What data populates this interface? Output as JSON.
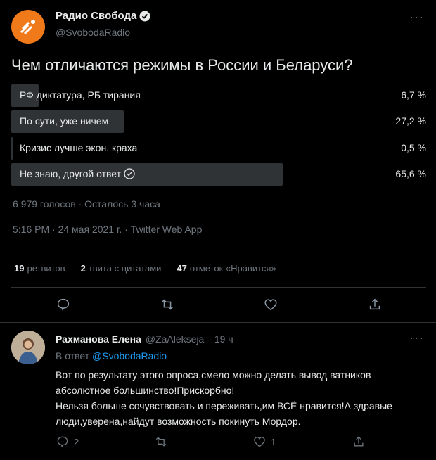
{
  "tweet": {
    "author_name": "Радио Свобода",
    "author_handle": "@SvobodaRadio",
    "more_label": "···",
    "question": "Чем отличаются режимы в России и Беларуси?",
    "poll": [
      {
        "label": "РФ диктатура, РБ тирания",
        "percent": "6,7 %",
        "value": 6.7
      },
      {
        "label": "По сути, уже ничем",
        "percent": "27,2 %",
        "value": 27.2
      },
      {
        "label": "Кризис лучше экон. краха",
        "percent": "0,5 %",
        "value": 0.5
      },
      {
        "label": "Не знаю, другой ответ",
        "percent": "65,6 %",
        "value": 65.6
      }
    ],
    "poll_meta": "6 979 голосов · Осталось 3 часа",
    "timestamp": "5:16 PM · 24 мая 2021 г. · Twitter Web App",
    "stats": {
      "retweets_count": "19",
      "retweets_label": "ретвитов",
      "quotes_count": "2",
      "quotes_label": "твита с цитатами",
      "likes_count": "47",
      "likes_label": "отметок «Нравится»"
    }
  },
  "reply": {
    "author_name": "Рахманова Елена",
    "author_handle": "@ZaAlekseja",
    "time": "· 19 ч",
    "more_label": "···",
    "reply_prefix": "В ответ",
    "reply_to": "@SvobodaRadio",
    "text": "Вот по результату этого опроса,смело можно делать вывод ватников\nабсолютное большинство!Прискорбно!\nНельзя больше сочувствовать и переживать,им ВСЁ нравится!А здравые\nлюди,уверена,найдут возможность покинуть Мордор.",
    "reply_count": "2",
    "like_count": "1"
  }
}
